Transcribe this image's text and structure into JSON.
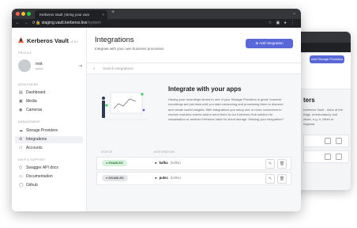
{
  "browser": {
    "tab_title": "Kerberos Vault | Bring your own",
    "new_tab": "+",
    "url_host": "staging.vault.kerberos.live",
    "url_path": "/system"
  },
  "app": {
    "name": "Kerberos Vault",
    "version": "v1.0.0"
  },
  "sidebar": {
    "profile_heading": "PROFILE",
    "user_name": "root",
    "user_role": "admin",
    "monitoring_heading": "MONITORING",
    "monitoring_items": [
      {
        "label": "Dashboard",
        "icon": "dashboard-icon"
      },
      {
        "label": "Media",
        "icon": "media-icon"
      },
      {
        "label": "Cameras",
        "icon": "camera-icon"
      }
    ],
    "management_heading": "MANAGEMENT",
    "management_items": [
      {
        "label": "Storage Providers",
        "icon": "storage-icon"
      },
      {
        "label": "Integrations",
        "icon": "integrations-icon",
        "active": true
      },
      {
        "label": "Accounts",
        "icon": "accounts-icon"
      }
    ],
    "help_heading": "HELP & SUPPORT",
    "help_items": [
      {
        "label": "Swagger API docs",
        "icon": "api-icon"
      },
      {
        "label": "Documentation",
        "icon": "docs-icon"
      },
      {
        "label": "Github",
        "icon": "github-icon"
      }
    ]
  },
  "main": {
    "title": "Integrations",
    "subtitle": "Integrate with your own business processes",
    "add_button": "Add Integration",
    "search_placeholder": "Search integrations",
    "content_title": "Integrate with your apps",
    "content_text": "Having your recordings stored in one of your Storage Providers is great, however recordings are just data until you start consuming and processing them to discover and create useful insights. With integrations you setup one or more connectors to receive real-time events and/or send them to our Kerberos Hub solution for visualisation or another Kerberos Vault for cloud storage. Missing your integration?",
    "columns": {
      "status": "STATUS",
      "integration": "INTEGRATION"
    },
    "rows": [
      {
        "status": "ENABLED",
        "name": "kafka",
        "type": "(kafka)"
      },
      {
        "status": "DISABLED",
        "name": "pulsc",
        "type": "(kafka)"
      }
    ]
  },
  "background_window": {
    "button": "Add Storage Providers",
    "title": "ters",
    "text": "Kerberos Vault - nd/or at the edge, e/redundancy and zsure, e.g. h, Minio or regional"
  },
  "colors": {
    "accent": "#5a67d8",
    "enabled_bg": "#d8f3dc",
    "enabled_fg": "#2f7a3d",
    "titlebar": "#35363a"
  }
}
